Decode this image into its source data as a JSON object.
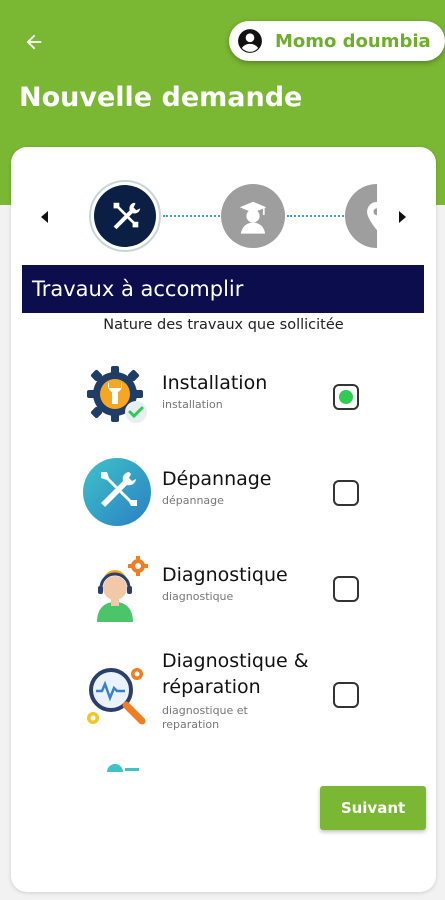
{
  "header": {
    "back_icon": "arrow-left-icon",
    "user_name": "Momo doumbia",
    "user_icon": "account-circle-icon",
    "title": "Nouvelle demande",
    "color": "#7ab833"
  },
  "stepper": {
    "prev_icon": "caret-left-icon",
    "next_icon": "caret-right-icon",
    "steps": [
      {
        "icon": "tools-icon",
        "state": "active"
      },
      {
        "icon": "graduate-icon",
        "state": "inactive"
      },
      {
        "icon": "location-icon",
        "state": "inactive"
      }
    ]
  },
  "section": {
    "title": "Travaux à accomplir",
    "subtitle": "Nature des travaux que sollicitée"
  },
  "jobs": [
    {
      "title": "Installation",
      "desc": "installation",
      "icon": "gear-wrench-check-icon",
      "checked": true
    },
    {
      "title": "Dépannage",
      "desc": "dépannage",
      "icon": "tools-circle-icon",
      "checked": false
    },
    {
      "title": "Diagnostique",
      "desc": "diagnostique",
      "icon": "support-agent-icon",
      "checked": false
    },
    {
      "title": "Diagnostique & réparation",
      "desc": "diagnostique et reparation",
      "icon": "magnifier-pulse-icon",
      "checked": false
    }
  ],
  "actions": {
    "next_label": "Suivant"
  },
  "colors": {
    "accent": "#7ab833",
    "navy": "#0b0d4d",
    "check": "#2ecc52"
  }
}
